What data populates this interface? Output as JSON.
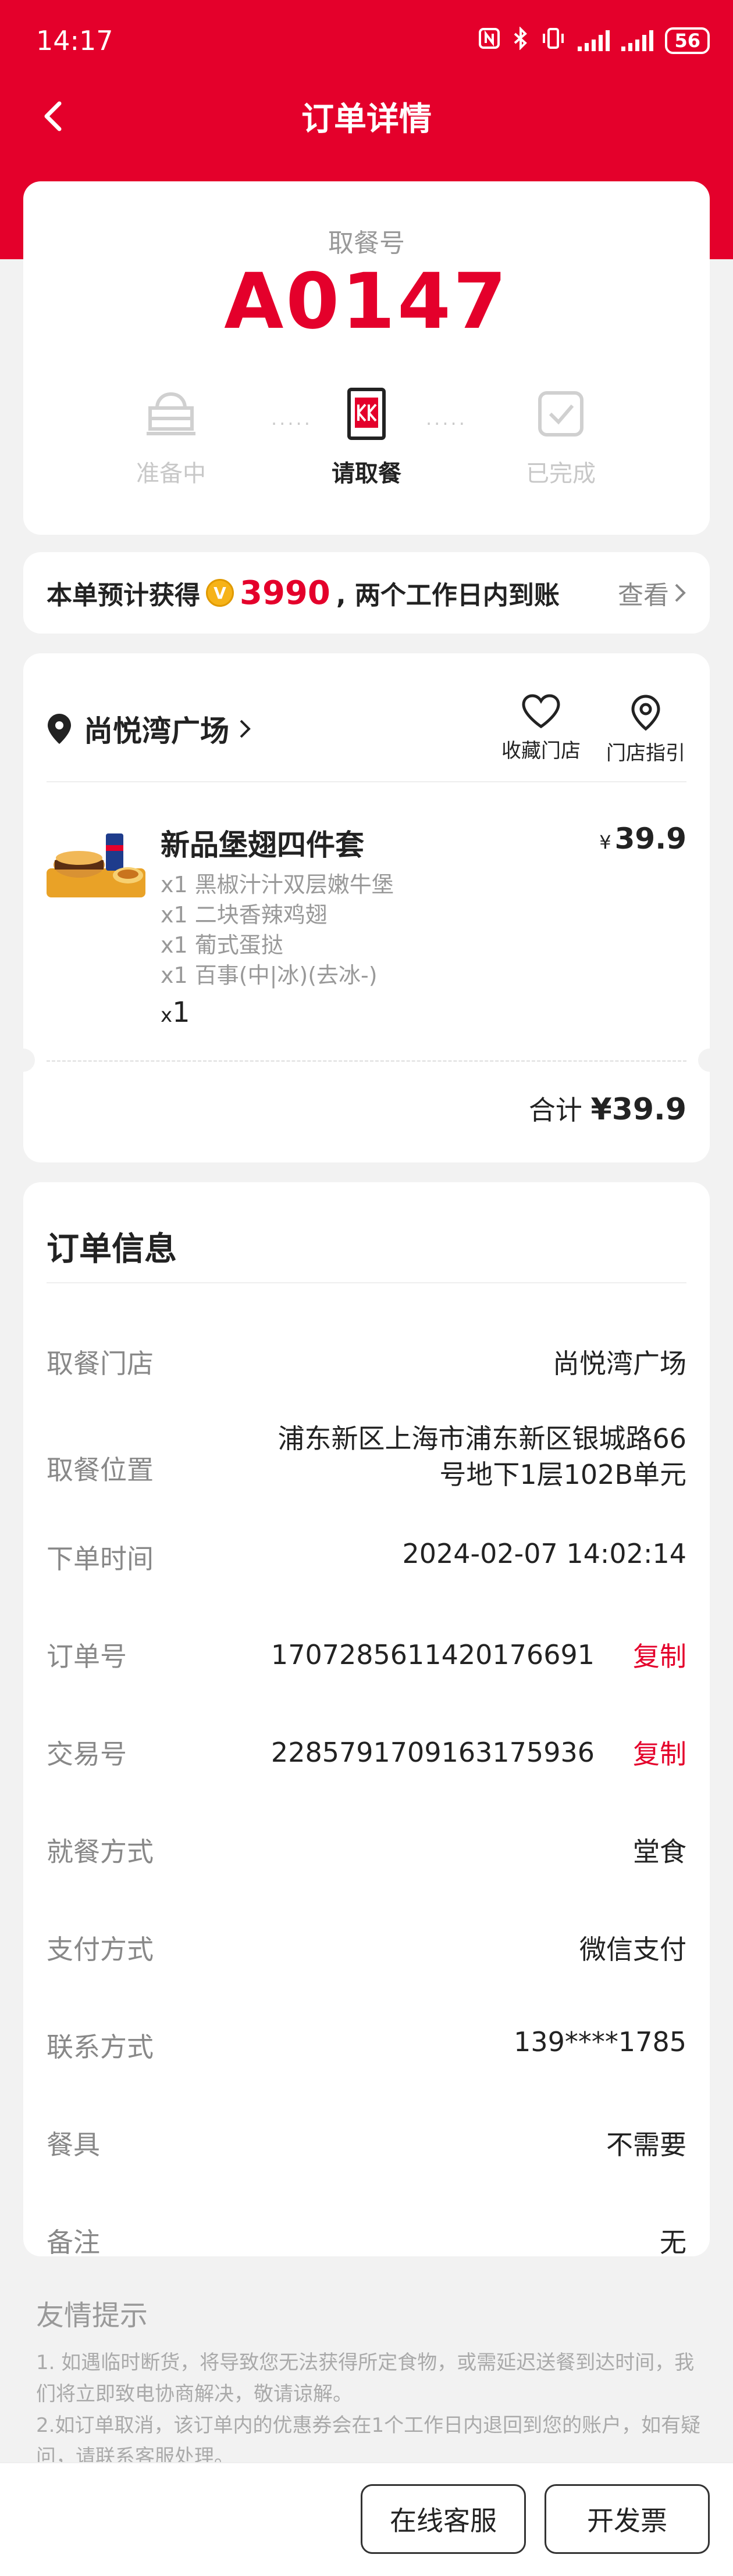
{
  "colors": {
    "brand_red": "#e4002b",
    "coin_gold": "#f6b318"
  },
  "status_bar": {
    "time": "14:17",
    "icons": [
      "nfc-icon",
      "bluetooth-icon",
      "vibrate-icon",
      "signal-icon",
      "signal-icon",
      "battery-icon"
    ],
    "battery": "56"
  },
  "nav": {
    "title": "订单详情",
    "back_icon": "chevron-left-icon"
  },
  "pickup": {
    "label": "取餐号",
    "code": "A0147",
    "steps": [
      {
        "label": "准备中",
        "icon": "burger-tray-icon",
        "state": "done"
      },
      {
        "label": "请取餐",
        "icon": "kfc-bag-icon",
        "state": "active"
      },
      {
        "label": "已完成",
        "icon": "check-cup-icon",
        "state": "pending"
      }
    ],
    "step_separator": "·····"
  },
  "points": {
    "prefix": "本单预计获得",
    "coin_symbol": "V",
    "amount": "3990",
    "suffix": ", 两个工作日内到账",
    "view_label": "查看",
    "view_icon": "chevron-right-icon"
  },
  "store": {
    "name": "尚悦湾广场",
    "name_icon": "location-pin-icon",
    "actions": [
      {
        "label": "收藏门店",
        "icon": "heart-icon"
      },
      {
        "label": "门店指引",
        "icon": "map-pin-icon"
      }
    ]
  },
  "item": {
    "name": "新品堡翅四件套",
    "currency": "¥",
    "price": "39.9",
    "components": [
      "x1 黑椒汁汁双层嫩牛堡",
      "x1 二块香辣鸡翅",
      "x1 葡式蛋挞",
      "x1 百事(中|冰)(去冰-)"
    ],
    "qty_prefix": "x",
    "qty": "1"
  },
  "total": {
    "label": "合计",
    "amount": "¥39.9"
  },
  "order_info": {
    "title": "订单信息",
    "rows": [
      {
        "label": "取餐门店",
        "value": "尚悦湾广场"
      },
      {
        "label": "取餐位置",
        "value_lines": [
          "浦东新区上海市浦东新区银城路66",
          "号地下1层102B单元"
        ]
      },
      {
        "label": "下单时间",
        "value": "2024-02-07 14:02:14"
      },
      {
        "label": "订单号",
        "value": "1707285611420176691",
        "action": "复制"
      },
      {
        "label": "交易号",
        "value": "2285791709163175936",
        "action": "复制"
      },
      {
        "label": "就餐方式",
        "value": "堂食"
      },
      {
        "label": "支付方式",
        "value": "微信支付"
      },
      {
        "label": "联系方式",
        "value": "139****1785"
      },
      {
        "label": "餐具",
        "value": "不需要"
      },
      {
        "label": "备注",
        "value": "无"
      }
    ]
  },
  "tips": {
    "title": "友情提示",
    "lines": [
      "1. 如遇临时断货，将导致您无法获得所定食物，或需延迟送餐到达时间，我",
      "们将立即致电协商解决，敬请谅解。",
      "2.如订单取消，该订单内的优惠券会在1个工作日内退回到您的账户，如有疑",
      "问，请联系客服处理。"
    ]
  },
  "bottom": {
    "service_label": "在线客服",
    "invoice_label": "开发票"
  }
}
